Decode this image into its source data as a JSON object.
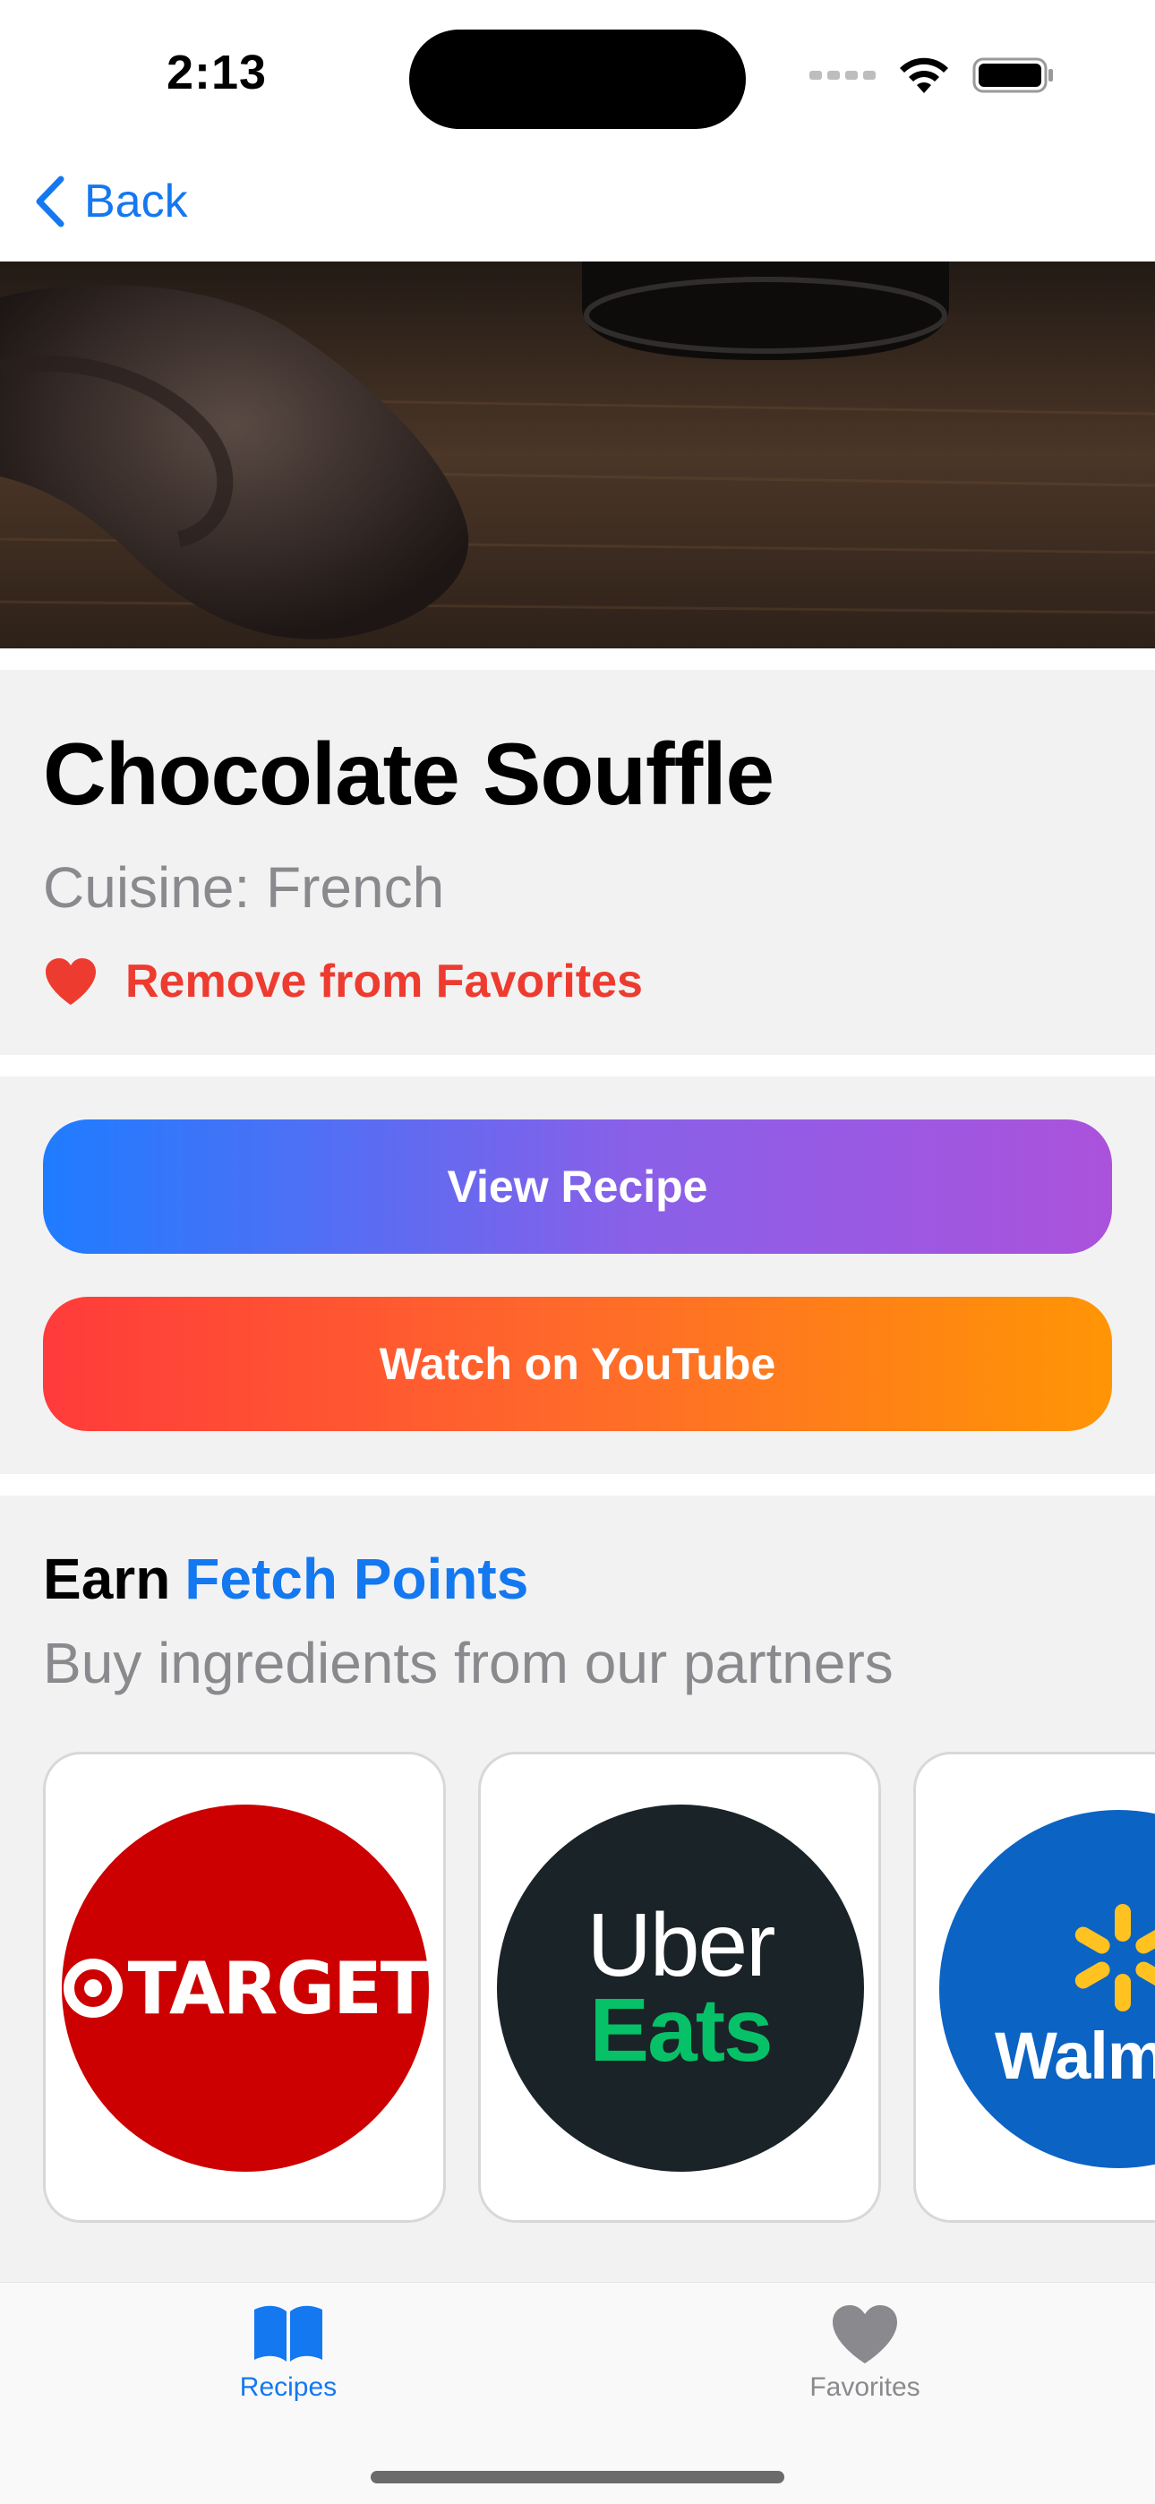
{
  "status_bar": {
    "time": "2:13"
  },
  "nav": {
    "back_label": "Back"
  },
  "recipe": {
    "name": "Chocolate Souffle",
    "cuisine": "Cuisine: French",
    "favorite_action": "Remove from Favorites",
    "is_favorite": true
  },
  "actions": {
    "view_recipe": "View Recipe",
    "watch_youtube": "Watch on YouTube"
  },
  "partners": {
    "heading_prefix": "Earn",
    "heading_accent": "Fetch Points",
    "subtitle": "Buy ingredients from our partners",
    "items": [
      {
        "name": "Target",
        "logo_text": "TARGET"
      },
      {
        "name": "Uber Eats",
        "logo_line1": "Uber",
        "logo_line2": "Eats"
      },
      {
        "name": "Walmart",
        "logo_text": "Walm"
      }
    ]
  },
  "tab_bar": {
    "tabs": [
      {
        "label": "Recipes",
        "icon": "book-icon",
        "selected": true
      },
      {
        "label": "Favorites",
        "icon": "heart-icon",
        "selected": false
      }
    ]
  },
  "colors": {
    "accent": "#1478f0",
    "destructive": "#ee3b30",
    "secondary_text": "#8a8a8e",
    "section_background": "#f2f2f2"
  }
}
